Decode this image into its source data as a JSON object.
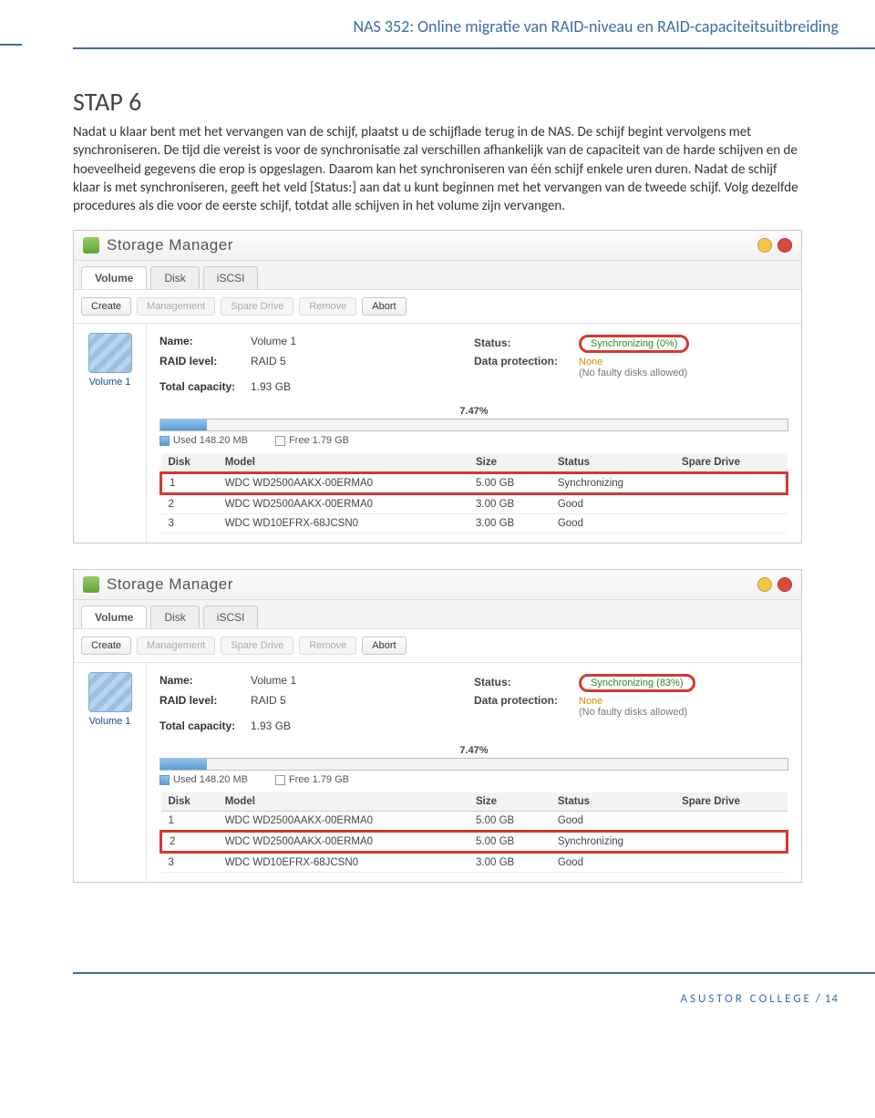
{
  "header": {
    "title": "NAS 352: Online migratie van RAID-niveau en RAID-capaciteitsuitbreiding"
  },
  "step": {
    "heading": "STAP 6",
    "para": "Nadat u klaar bent met het vervangen van de schijf, plaatst u de schijflade terug in de NAS. De schijf begint vervolgens met synchroniseren. De tijd die vereist is voor de synchronisatie zal verschillen afhankelijk van de capaciteit van de harde schijven en de hoeveelheid gegevens die erop is opgeslagen. Daarom kan het synchroniseren van één schijf enkele uren duren. Nadat de schijf klaar is met synchroniseren, geeft het veld [Status:] aan dat u kunt beginnen met het vervangen van de tweede schijf. Volg dezelfde procedures als die voor de eerste schijf, totdat alle schijven in het volume zijn vervangen."
  },
  "app": {
    "title": "Storage Manager",
    "tabs": {
      "volume": "Volume",
      "disk": "Disk",
      "iscsi": "iSCSI"
    },
    "buttons": {
      "create": "Create",
      "management": "Management",
      "spare": "Spare Drive",
      "remove": "Remove",
      "abort": "Abort"
    },
    "sidebar": {
      "vol_label": "Volume 1"
    },
    "labels": {
      "name": "Name:",
      "status": "Status:",
      "raid": "RAID level:",
      "dp": "Data protection:",
      "total": "Total capacity:",
      "used": "Used",
      "free": "Free"
    },
    "headers": {
      "disk": "Disk",
      "model": "Model",
      "size": "Size",
      "status": "Status",
      "spare": "Spare Drive"
    }
  },
  "screens": [
    {
      "details": {
        "name": "Volume 1",
        "raid": "RAID 5",
        "capacity": "1.93 GB",
        "status": "Synchronizing (0%)",
        "dp": "None",
        "dp_note": "(No faulty disks allowed)"
      },
      "progress": {
        "pct_text": "7.47%",
        "fill_pct": 7.47,
        "used": "148.20 MB",
        "free": "1.79 GB"
      },
      "rows": [
        {
          "disk": "1",
          "model": "WDC WD2500AAKX-00ERMA0",
          "size": "5.00 GB",
          "status": "Synchronizing",
          "hl": true
        },
        {
          "disk": "2",
          "model": "WDC WD2500AAKX-00ERMA0",
          "size": "3.00 GB",
          "status": "Good",
          "hl": false
        },
        {
          "disk": "3",
          "model": "WDC WD10EFRX-68JCSN0",
          "size": "3.00 GB",
          "status": "Good",
          "hl": false
        }
      ]
    },
    {
      "details": {
        "name": "Volume 1",
        "raid": "RAID 5",
        "capacity": "1.93 GB",
        "status": "Synchronizing (83%)",
        "dp": "None",
        "dp_note": "(No faulty disks allowed)"
      },
      "progress": {
        "pct_text": "7.47%",
        "fill_pct": 7.47,
        "used": "148.20 MB",
        "free": "1.79 GB"
      },
      "rows": [
        {
          "disk": "1",
          "model": "WDC WD2500AAKX-00ERMA0",
          "size": "5.00 GB",
          "status": "Good",
          "hl": false
        },
        {
          "disk": "2",
          "model": "WDC WD2500AAKX-00ERMA0",
          "size": "5.00 GB",
          "status": "Synchronizing",
          "hl": true
        },
        {
          "disk": "3",
          "model": "WDC WD10EFRX-68JCSN0",
          "size": "3.00 GB",
          "status": "Good",
          "hl": false
        }
      ]
    }
  ],
  "footer": {
    "brand": "ASUSTOR COLLEGE",
    "sep": " / ",
    "page": "14"
  }
}
